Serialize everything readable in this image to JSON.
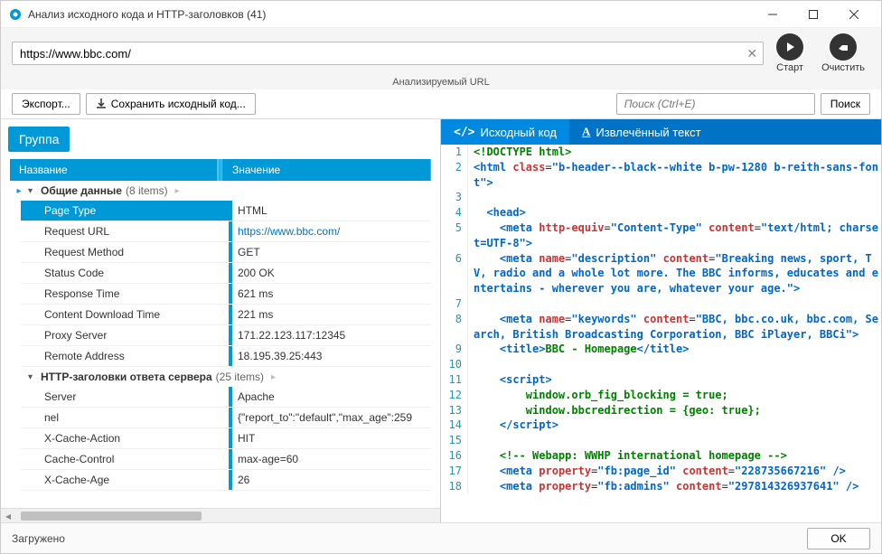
{
  "window": {
    "title": "Анализ исходного кода и HTTP-заголовков (41)",
    "icon_color": "#0099d8"
  },
  "url_bar": {
    "value": "https://www.bbc.com/",
    "sublabel": "Анализируемый URL",
    "start_label": "Старт",
    "clear_label": "Очистить"
  },
  "toolbar": {
    "export": "Экспорт...",
    "save_source": "Сохранить исходный код...",
    "search_placeholder": "Поиск (Ctrl+E)",
    "search_btn": "Поиск"
  },
  "grid": {
    "group_label": "Группа",
    "col_name": "Название",
    "col_value": "Значение",
    "groups": [
      {
        "title": "Общие данные",
        "count": "(8 items)",
        "rows": [
          {
            "name": "Page Type",
            "value": "HTML",
            "selected": true
          },
          {
            "name": "Request URL",
            "value": "https://www.bbc.com/",
            "link": true
          },
          {
            "name": "Request Method",
            "value": "GET"
          },
          {
            "name": "Status Code",
            "value": "200 OK"
          },
          {
            "name": "Response Time",
            "value": "621 ms"
          },
          {
            "name": "Content Download Time",
            "value": "221 ms"
          },
          {
            "name": "Proxy Server",
            "value": "171.22.123.117:12345"
          },
          {
            "name": "Remote Address",
            "value": "18.195.39.25:443"
          }
        ]
      },
      {
        "title": "HTTP-заголовки ответа сервера",
        "count": "(25 items)",
        "rows": [
          {
            "name": "Server",
            "value": "Apache"
          },
          {
            "name": "nel",
            "value": "{\"report_to\":\"default\",\"max_age\":259"
          },
          {
            "name": "X-Cache-Action",
            "value": "HIT"
          },
          {
            "name": "Cache-Control",
            "value": "max-age=60"
          },
          {
            "name": "X-Cache-Age",
            "value": "26"
          }
        ]
      }
    ]
  },
  "tabs": {
    "source": "Исходный код",
    "extracted": "Извлечённый текст"
  },
  "source_lines": [
    {
      "n": 1,
      "html": "<span class='t-txt'>&lt;!DOCTYPE html&gt;</span>"
    },
    {
      "n": 2,
      "html": "<span class='t-tag'>&lt;html</span> <span class='t-attr'>class</span>=<span class='t-str'>\"b-header--black--white b-pw-1280 b-reith-sans-font\"</span><span class='t-tag'>&gt;</span>"
    },
    {
      "n": 3,
      "html": ""
    },
    {
      "n": 4,
      "html": "  <span class='t-tag'>&lt;head&gt;</span>"
    },
    {
      "n": 5,
      "html": "    <span class='t-tag'>&lt;meta</span> <span class='t-attr'>http-equiv</span>=<span class='t-str'>\"Content-Type\"</span> <span class='t-attr'>content</span>=<span class='t-str'>\"text/html; charset=UTF-8\"</span><span class='t-tag'>&gt;</span>"
    },
    {
      "n": 6,
      "html": "    <span class='t-tag'>&lt;meta</span> <span class='t-attr'>name</span>=<span class='t-str'>\"description\"</span> <span class='t-attr'>content</span>=<span class='t-str'>\"Breaking news, sport, TV, radio and a whole lot more. The BBC informs, educates and entertains - wherever you are, whatever your age.\"</span><span class='t-tag'>&gt;</span>"
    },
    {
      "n": 7,
      "html": ""
    },
    {
      "n": 8,
      "html": "    <span class='t-tag'>&lt;meta</span> <span class='t-attr'>name</span>=<span class='t-str'>\"keywords\"</span> <span class='t-attr'>content</span>=<span class='t-str'>\"BBC, bbc.co.uk, bbc.com, Search, British Broadcasting Corporation, BBC iPlayer, BBCi\"</span><span class='t-tag'>&gt;</span>"
    },
    {
      "n": 9,
      "html": "    <span class='t-tag'>&lt;title&gt;</span><span class='t-txt'>BBC - Homepage</span><span class='t-tag'>&lt;/title&gt;</span>"
    },
    {
      "n": 10,
      "html": ""
    },
    {
      "n": 11,
      "html": "    <span class='t-tag'>&lt;script&gt;</span>"
    },
    {
      "n": 12,
      "html": "        <span class='t-txt'>window.orb_fig_blocking = true;</span>"
    },
    {
      "n": 13,
      "html": "        <span class='t-txt'>window.bbcredirection = {geo: true};</span>"
    },
    {
      "n": 14,
      "html": "    <span class='t-tag'>&lt;/script&gt;</span>"
    },
    {
      "n": 15,
      "html": ""
    },
    {
      "n": 16,
      "html": "    <span class='t-txt'>&lt;!-- Webapp: WWHP international homepage --&gt;</span>"
    },
    {
      "n": 17,
      "html": "    <span class='t-tag'>&lt;meta</span> <span class='t-attr'>property</span>=<span class='t-str'>\"fb:page_id\"</span> <span class='t-attr'>content</span>=<span class='t-str'>\"228735667216\"</span> <span class='t-tag'>/&gt;</span>"
    },
    {
      "n": 18,
      "html": "    <span class='t-tag'>&lt;meta</span> <span class='t-attr'>property</span>=<span class='t-str'>\"fb:admins\"</span> <span class='t-attr'>content</span>=<span class='t-str'>\"297814326937641\"</span> <span class='t-tag'>/&gt;</span>"
    }
  ],
  "status": {
    "text": "Загружено",
    "ok": "OK"
  }
}
